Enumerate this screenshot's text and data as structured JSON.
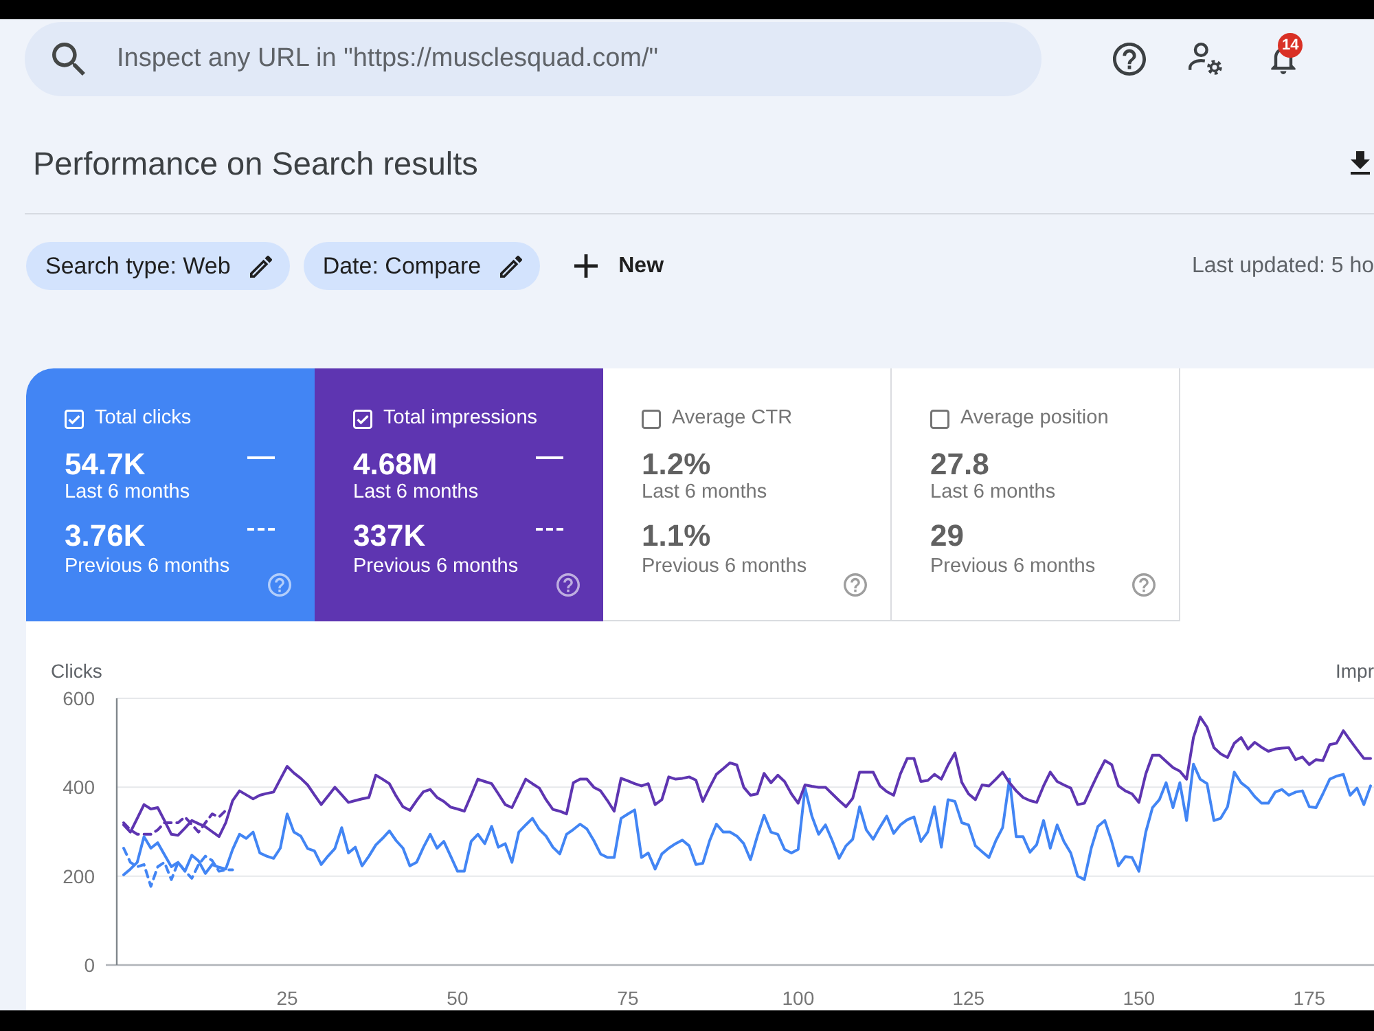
{
  "top_bar": {
    "search": {
      "placeholder": "Inspect any URL in \"https://musclesquad.com/\""
    },
    "notifications": {
      "badge": "14"
    }
  },
  "header": {
    "title": "Performance on Search results"
  },
  "filters": {
    "chips": [
      {
        "label": "Search type: Web"
      },
      {
        "label": "Date: Compare"
      }
    ],
    "new_button": "New",
    "last_updated": "Last updated: 5 ho"
  },
  "metrics": [
    {
      "label": "Total clicks",
      "checked": true,
      "color": "#4285f4",
      "current": {
        "value": "54.7K",
        "period": "Last 6 months"
      },
      "previous": {
        "value": "3.76K",
        "period": "Previous 6 months"
      }
    },
    {
      "label": "Total impressions",
      "checked": true,
      "color": "#5e35b1",
      "current": {
        "value": "4.68M",
        "period": "Last 6 months"
      },
      "previous": {
        "value": "337K",
        "period": "Previous 6 months"
      }
    },
    {
      "label": "Average CTR",
      "checked": false,
      "current": {
        "value": "1.2%",
        "period": "Last 6 months"
      },
      "previous": {
        "value": "1.1%",
        "period": "Previous 6 months"
      }
    },
    {
      "label": "Average position",
      "checked": false,
      "current": {
        "value": "27.8",
        "period": "Last 6 months"
      },
      "previous": {
        "value": "29",
        "period": "Previous 6 months"
      }
    }
  ],
  "chart": {
    "right_axis_label": "Impr",
    "chart_data": {
      "type": "line",
      "ylabel": "Clicks",
      "xlim": [
        0,
        184.5
      ],
      "ylim": [
        0,
        600
      ],
      "xticks": [
        25,
        50,
        75,
        100,
        125,
        150,
        175
      ],
      "yticks": [
        0,
        200,
        400,
        600
      ],
      "x": [
        1,
        2,
        3,
        4,
        5,
        6,
        7,
        8,
        9,
        10,
        11,
        12,
        13,
        14,
        15,
        16,
        17,
        18,
        19,
        20,
        21,
        22,
        23,
        24,
        25,
        26,
        27,
        28,
        29,
        30,
        31,
        32,
        33,
        34,
        35,
        36,
        37,
        38,
        39,
        40,
        41,
        42,
        43,
        44,
        45,
        46,
        47,
        48,
        49,
        50,
        51,
        52,
        53,
        54,
        55,
        56,
        57,
        58,
        59,
        60,
        61,
        62,
        63,
        64,
        65,
        66,
        67,
        68,
        69,
        70,
        71,
        72,
        73,
        74,
        75,
        76,
        77,
        78,
        79,
        80,
        81,
        82,
        83,
        84,
        85,
        86,
        87,
        88,
        89,
        90,
        91,
        92,
        93,
        94,
        95,
        96,
        97,
        98,
        99,
        100,
        101,
        102,
        103,
        104,
        105,
        106,
        107,
        108,
        109,
        110,
        111,
        112,
        113,
        114,
        115,
        116,
        117,
        118,
        119,
        120,
        121,
        122,
        123,
        124,
        125,
        126,
        127,
        128,
        129,
        130,
        131,
        132,
        133,
        134,
        135,
        136,
        137,
        138,
        139,
        140,
        141,
        142,
        143,
        144,
        145,
        146,
        147,
        148,
        149,
        150,
        151,
        152,
        153,
        154,
        155,
        156,
        157,
        158,
        159,
        160,
        161,
        162,
        163,
        164,
        165,
        166,
        167,
        168,
        169,
        170,
        171,
        172,
        173,
        174,
        175,
        176,
        177,
        178,
        179,
        180,
        181,
        182,
        183,
        184
      ],
      "series": [
        {
          "color": "#4285f4",
          "line_style": "solid",
          "values": [
            203,
            216,
            231,
            289,
            263,
            275,
            248,
            221,
            231,
            211,
            247,
            234,
            206,
            226,
            220,
            216,
            260,
            294,
            285,
            299,
            252,
            245,
            240,
            263,
            340,
            299,
            290,
            262,
            257,
            226,
            245,
            262,
            309,
            252,
            265,
            223,
            245,
            270,
            285,
            302,
            280,
            263,
            223,
            231,
            265,
            294,
            263,
            278,
            245,
            211,
            211,
            278,
            294,
            273,
            312,
            265,
            273,
            231,
            299,
            315,
            330,
            305,
            290,
            265,
            250,
            294,
            305,
            317,
            306,
            280,
            250,
            242,
            242,
            330,
            340,
            349,
            242,
            252,
            216,
            250,
            263,
            273,
            281,
            268,
            226,
            229,
            280,
            317,
            299,
            299,
            290,
            273,
            237,
            290,
            337,
            299,
            294,
            260,
            252,
            260,
            398,
            335,
            294,
            315,
            280,
            240,
            268,
            283,
            356,
            304,
            283,
            310,
            335,
            296,
            315,
            327,
            333,
            278,
            299,
            356,
            265,
            372,
            368,
            320,
            315,
            268,
            255,
            242,
            280,
            309,
            418,
            289,
            289,
            254,
            271,
            325,
            263,
            315,
            278,
            252,
            200,
            192,
            263,
            312,
            325,
            278,
            223,
            244,
            242,
            211,
            299,
            354,
            372,
            410,
            354,
            410,
            325,
            452,
            418,
            408,
            325,
            330,
            356,
            434,
            410,
            398,
            379,
            364,
            364,
            389,
            395,
            382,
            389,
            392,
            356,
            354,
            385,
            418,
            425,
            429,
            382,
            398,
            361,
            403
          ]
        },
        {
          "color": "#5e35b1",
          "line_style": "solid",
          "values": [
            315,
            299,
            330,
            361,
            351,
            354,
            325,
            294,
            292,
            308,
            325,
            318,
            311,
            300,
            289,
            320,
            370,
            392,
            383,
            374,
            382,
            386,
            389,
            418,
            447,
            432,
            420,
            405,
            383,
            361,
            380,
            400,
            383,
            366,
            370,
            374,
            377,
            427,
            418,
            408,
            380,
            356,
            348,
            370,
            390,
            395,
            377,
            368,
            355,
            351,
            346,
            382,
            418,
            413,
            408,
            385,
            361,
            354,
            386,
            418,
            408,
            398,
            372,
            350,
            346,
            340,
            410,
            418,
            418,
            400,
            392,
            370,
            346,
            420,
            414,
            408,
            403,
            408,
            361,
            372,
            423,
            418,
            420,
            423,
            416,
            368,
            400,
            429,
            442,
            455,
            450,
            400,
            382,
            385,
            431,
            410,
            427,
            413,
            385,
            364,
            405,
            402,
            400,
            400,
            385,
            370,
            356,
            375,
            434,
            434,
            434,
            403,
            390,
            382,
            430,
            465,
            465,
            413,
            415,
            429,
            418,
            450,
            477,
            411,
            385,
            372,
            405,
            403,
            418,
            434,
            410,
            392,
            377,
            370,
            366,
            403,
            434,
            413,
            405,
            398,
            361,
            364,
            398,
            430,
            460,
            451,
            403,
            392,
            385,
            366,
            430,
            472,
            472,
            458,
            444,
            436,
            418,
            512,
            558,
            535,
            489,
            475,
            467,
            499,
            512,
            486,
            501,
            490,
            481,
            486,
            488,
            489,
            462,
            468,
            451,
            462,
            460,
            496,
            499,
            527,
            506,
            485,
            465,
            465
          ]
        },
        {
          "color": "#4285f4",
          "line_style": "dashed",
          "values": [
            263,
            231,
            221,
            226,
            177,
            221,
            231,
            192,
            231,
            212,
            195,
            226,
            245,
            235,
            211,
            214,
            214,
            null,
            null,
            null,
            null,
            null,
            null,
            null,
            null,
            null,
            null,
            null,
            null,
            null,
            null,
            null,
            null,
            null,
            null,
            null,
            null,
            null,
            null,
            null,
            null,
            null,
            null,
            null,
            null,
            null,
            null,
            null,
            null,
            null,
            null,
            null,
            null,
            null,
            null,
            null,
            null,
            null,
            null,
            null,
            null,
            null,
            null,
            null,
            null,
            null,
            null,
            null,
            null,
            null,
            null,
            null,
            null,
            null,
            null,
            null,
            null,
            null,
            null,
            null,
            null,
            null,
            null,
            null,
            null,
            null,
            null,
            null,
            null,
            null,
            null,
            null,
            null,
            null,
            null,
            null,
            null,
            null,
            null,
            null,
            null,
            null,
            null,
            null,
            null,
            null,
            null,
            null,
            null,
            null,
            null,
            null,
            null,
            null,
            null,
            null,
            null,
            null,
            null,
            null,
            null,
            null,
            null,
            null,
            null,
            null,
            null,
            null,
            null,
            null,
            null,
            null,
            null,
            null,
            null,
            null,
            null,
            null,
            null,
            null,
            null,
            null,
            null,
            null,
            null,
            null,
            null,
            null,
            null,
            null,
            null,
            null,
            null,
            null,
            null,
            null,
            null,
            null,
            null,
            null,
            null,
            null,
            null,
            null,
            null,
            null,
            null,
            null,
            null,
            null,
            null,
            null,
            null,
            null,
            null,
            null,
            null,
            null,
            null,
            null,
            null,
            null,
            null,
            null
          ]
        },
        {
          "color": "#5e35b1",
          "line_style": "dashed",
          "values": [
            320,
            304,
            294,
            294,
            294,
            304,
            320,
            320,
            320,
            333,
            316,
            299,
            320,
            340,
            333,
            348,
            null,
            null,
            null,
            null,
            null,
            null,
            null,
            null,
            null,
            null,
            null,
            null,
            null,
            null,
            null,
            null,
            null,
            null,
            null,
            null,
            null,
            null,
            null,
            null,
            null,
            null,
            null,
            null,
            null,
            null,
            null,
            null,
            null,
            null,
            null,
            null,
            null,
            null,
            null,
            null,
            null,
            null,
            null,
            null,
            null,
            null,
            null,
            null,
            null,
            null,
            null,
            null,
            null,
            null,
            null,
            null,
            null,
            null,
            null,
            null,
            null,
            null,
            null,
            null,
            null,
            null,
            null,
            null,
            null,
            null,
            null,
            null,
            null,
            null,
            null,
            null,
            null,
            null,
            null,
            null,
            null,
            null,
            null,
            null,
            null,
            null,
            null,
            null,
            null,
            null,
            null,
            null,
            null,
            null,
            null,
            null,
            null,
            null,
            null,
            null,
            null,
            null,
            null,
            null,
            null,
            null,
            null,
            null,
            null,
            null,
            null,
            null,
            null,
            null,
            null,
            null,
            null,
            null,
            null,
            null,
            null,
            null,
            null,
            null,
            null,
            null,
            null,
            null,
            null,
            null,
            null,
            null,
            null,
            null,
            null,
            null,
            null,
            null,
            null,
            null,
            null,
            null,
            null,
            null,
            null,
            null,
            null,
            null,
            null,
            null,
            null,
            null,
            null,
            null,
            null,
            null,
            null,
            null,
            null,
            null,
            null,
            null,
            null,
            null,
            null,
            null,
            null,
            null
          ]
        }
      ]
    }
  }
}
